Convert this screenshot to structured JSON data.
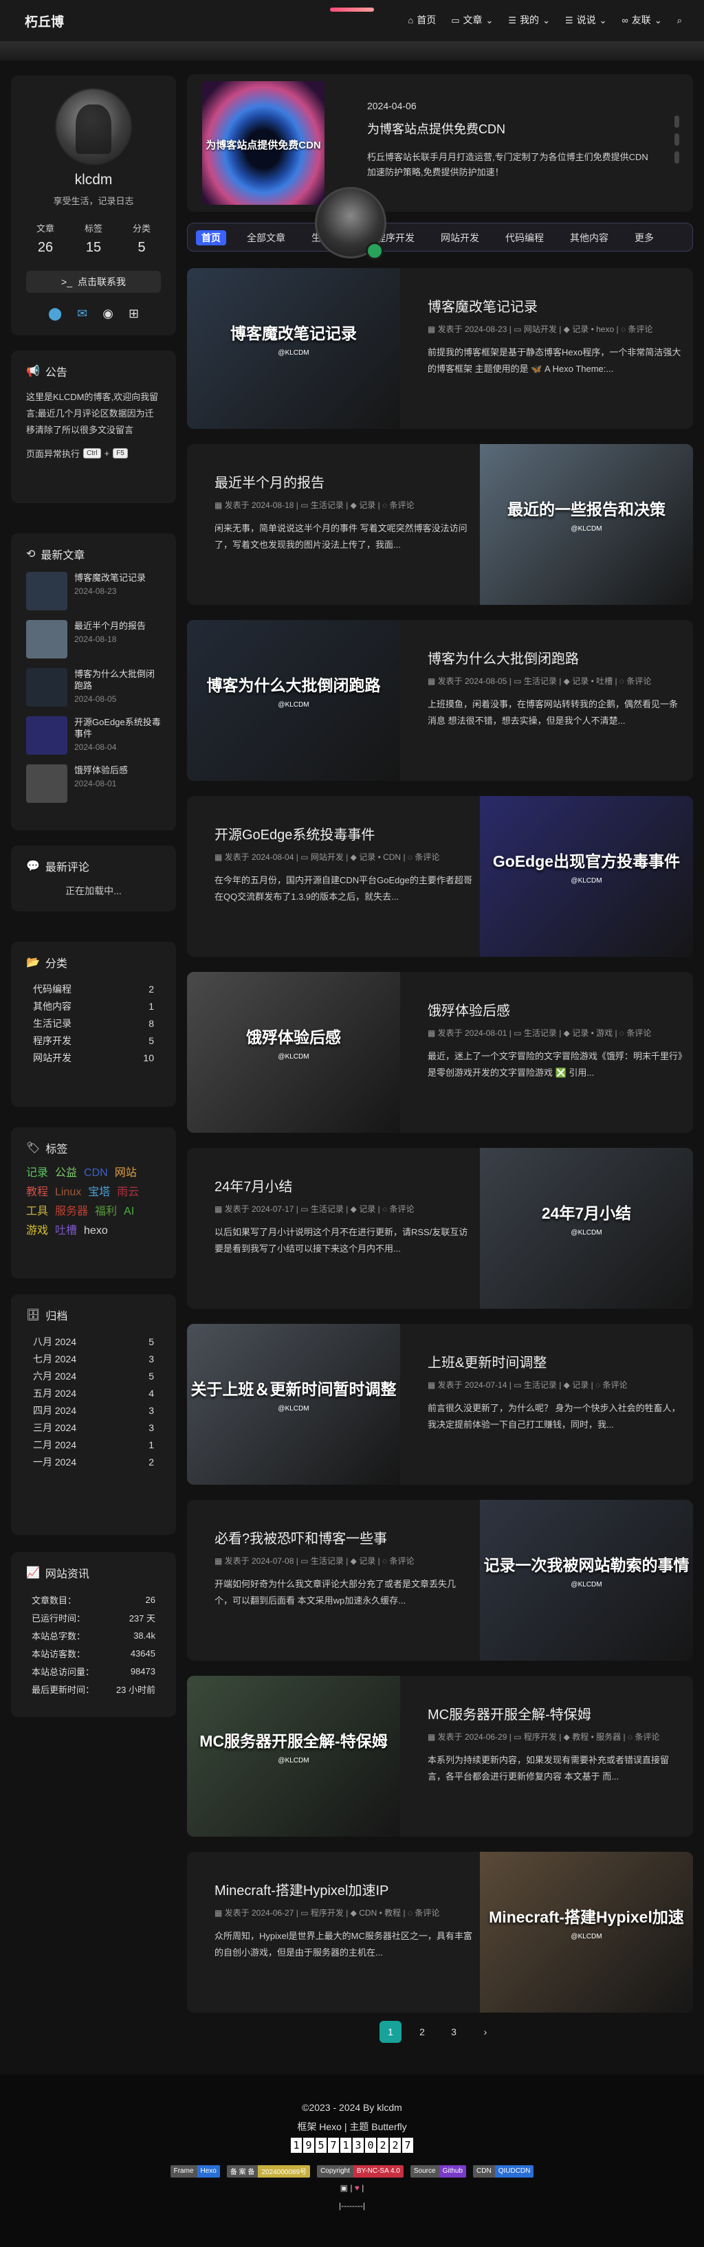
{
  "site": {
    "title": "朽丘博"
  },
  "nav": [
    {
      "label": "首页",
      "icon": "home-icon",
      "glyph": "⌂"
    },
    {
      "label": "文章",
      "icon": "folder-icon",
      "glyph": "▭"
    },
    {
      "label": "我的",
      "icon": "list-icon",
      "glyph": "☰"
    },
    {
      "label": "说说",
      "icon": "list-icon",
      "glyph": "☰"
    },
    {
      "label": "友联",
      "icon": "link-icon",
      "glyph": "∞"
    }
  ],
  "profile": {
    "name": "klcdm",
    "desc": "享受生活，记录日志",
    "stats": [
      {
        "label": "文章",
        "value": "26"
      },
      {
        "label": "标签",
        "value": "15"
      },
      {
        "label": "分类",
        "value": "5"
      }
    ],
    "contact": "点击联系我"
  },
  "notice": {
    "title": "公告",
    "body": "这里是KLCDM的博客,欢迎向我留言;最近几个月评论区数据因为迁移清除了所以很多文没留言",
    "foot_prefix": "页面异常执行",
    "key1": "Ctrl",
    "plus": "+",
    "key2": "F5"
  },
  "recent": {
    "title": "最新文章",
    "items": [
      {
        "title": "博客魔改笔记记录",
        "date": "2024-08-23"
      },
      {
        "title": "最近半个月的报告",
        "date": "2024-08-18"
      },
      {
        "title": "博客为什么大批倒闭跑路",
        "date": "2024-08-05"
      },
      {
        "title": "开源GoEdge系统投毒事件",
        "date": "2024-08-04"
      },
      {
        "title": "饿殍体验后感",
        "date": "2024-08-01"
      }
    ]
  },
  "comments": {
    "title": "最新评论",
    "loading": "正在加载中..."
  },
  "categories": {
    "title": "分类",
    "items": [
      {
        "name": "代码编程",
        "count": "2"
      },
      {
        "name": "其他内容",
        "count": "1"
      },
      {
        "name": "生活记录",
        "count": "8"
      },
      {
        "name": "程序开发",
        "count": "5"
      },
      {
        "name": "网站开发",
        "count": "10"
      }
    ]
  },
  "tags": {
    "title": "标签",
    "items": [
      {
        "name": "记录",
        "color": "#5cc35c"
      },
      {
        "name": "公益",
        "color": "#7cc86a"
      },
      {
        "name": "CDN",
        "color": "#3d62c8"
      },
      {
        "name": "网站",
        "color": "#e0a040"
      },
      {
        "name": "教程",
        "color": "#d0504a"
      },
      {
        "name": "Linux",
        "color": "#a05a3a"
      },
      {
        "name": "宝塔",
        "color": "#4aa0d8"
      },
      {
        "name": "雨云",
        "color": "#b03040"
      },
      {
        "name": "工具",
        "color": "#c8b040"
      },
      {
        "name": "服务器",
        "color": "#c04030"
      },
      {
        "name": "福利",
        "color": "#5a9a3a"
      },
      {
        "name": "AI",
        "color": "#4ab040"
      },
      {
        "name": "游戏",
        "color": "#d8c030"
      },
      {
        "name": "吐槽",
        "color": "#7a58c8"
      },
      {
        "name": "hexo",
        "color": "#d8d8d8"
      }
    ]
  },
  "archive": {
    "title": "归档",
    "items": [
      {
        "name": "八月 2024",
        "count": "5"
      },
      {
        "name": "七月 2024",
        "count": "3"
      },
      {
        "name": "六月 2024",
        "count": "5"
      },
      {
        "name": "五月 2024",
        "count": "4"
      },
      {
        "name": "四月 2024",
        "count": "3"
      },
      {
        "name": "三月 2024",
        "count": "3"
      },
      {
        "name": "二月 2024",
        "count": "1"
      },
      {
        "name": "一月 2024",
        "count": "2"
      }
    ]
  },
  "site_info": {
    "title": "网站资讯",
    "items": [
      {
        "name": "文章数目：",
        "value": "26"
      },
      {
        "name": "已运行时间：",
        "value": "237 天"
      },
      {
        "name": "本站总字数：",
        "value": "38.4k"
      },
      {
        "name": "本站访客数：",
        "value": "43645"
      },
      {
        "name": "本站总访问量：",
        "value": "98473"
      },
      {
        "name": "最后更新时间：",
        "value": "23 小时前"
      }
    ]
  },
  "hero": {
    "date": "2024-04-06",
    "title": "为博客站点提供免费CDN",
    "desc": "朽丘博客站长联手月月打造运营,专门定制了为各位博主们免费提供CDN加速防护策略,免费提供防护加速！",
    "img_text": "为博客站点提供免费CDN"
  },
  "tabs": [
    "首页",
    "全部文章",
    "生活记录",
    "程序开发",
    "网站开发",
    "代码编程",
    "其他内容",
    "更多"
  ],
  "posts": [
    {
      "title": "博客魔改笔记记录",
      "date": "发表于 2024-08-23",
      "category": "网站开发",
      "tags": "记录 • hexo",
      "comments": "条评论",
      "excerpt": "前提我的博客框架是基于静态博客Hexo程序，一个非常简洁强大的博客框架 主题使用的是 🦋 A Hexo Theme:...",
      "img_text": "博客魔改笔记记录",
      "img_sub": "@KLCDM",
      "img_bg": "#2c3848",
      "img_side": "left"
    },
    {
      "title": "最近半个月的报告",
      "date": "发表于 2024-08-18",
      "category": "生活记录",
      "tags": "记录",
      "comments": "条评论",
      "excerpt": "闲来无事，简单说说这半个月的事件 写着文呢突然博客没法访问了，写着文也发现我的图片没法上传了，我面...",
      "img_text": "最近的一些报告和决策",
      "img_sub": "@KLCDM",
      "img_bg": "#5a6a78",
      "img_side": "right"
    },
    {
      "title": "博客为什么大批倒闭跑路",
      "date": "发表于 2024-08-05",
      "category": "生活记录",
      "tags": "记录 • 吐槽",
      "comments": "条评论",
      "excerpt": "上班摸鱼，闲着没事，在博客网站转转我的企鹅，偶然看见一条消息 想法很不错，想去实操，但是我个人不清楚...",
      "img_text": "博客为什么大批倒闭跑路",
      "img_sub": "@KLCDM",
      "img_bg": "#222a36",
      "img_side": "left"
    },
    {
      "title": "开源GoEdge系统投毒事件",
      "date": "发表于 2024-08-04",
      "category": "网站开发",
      "tags": "记录 • CDN",
      "comments": "条评论",
      "excerpt": "在今年的五月份，国内开源自建CDN平台GoEdge的主要作者超哥在QQ交流群发布了1.3.9的版本之后，就失去...",
      "img_text": "GoEdge出现官方投毒事件",
      "img_sub": "@KLCDM",
      "img_bg": "#2a2a6a",
      "img_side": "right"
    },
    {
      "title": "饿殍体验后感",
      "date": "发表于 2024-08-01",
      "category": "生活记录",
      "tags": "记录 • 游戏",
      "comments": "条评论",
      "excerpt": "最近，迷上了一个文字冒险的文字冒险游戏《饿殍：明末千里行》是零创游戏开发的文字冒险游戏 ❎ 引用...",
      "img_text": "饿殍体验后感",
      "img_sub": "@KLCDM",
      "img_bg": "#4a4a4a",
      "img_side": "left"
    },
    {
      "title": "24年7月小结",
      "date": "发表于 2024-07-17",
      "category": "生活记录",
      "tags": "记录",
      "comments": "条评论",
      "excerpt": "以后如果写了月小计说明这个月不在进行更新，请RSS/友联互访要是看到我写了小结可以接下来这个月内不用...",
      "img_text": "24年7月小结",
      "img_sub": "@KLCDM",
      "img_bg": "#3a4048",
      "img_side": "right"
    },
    {
      "title": "上班&更新时间调整",
      "date": "发表于 2024-07-14",
      "category": "生活记录",
      "tags": "记录",
      "comments": "条评论",
      "excerpt": "前言很久没更新了，为什么呢？ 身为一个快步入社会的牲畜人，我决定提前体验一下自己打工赚钱，同时，我...",
      "img_text": "关于上班＆更新时间暂时调整",
      "img_sub": "@KLCDM",
      "img_bg": "#4a5058",
      "img_side": "left"
    },
    {
      "title": "必看?我被恐吓和博客一些事",
      "date": "发表于 2024-07-08",
      "category": "生活记录",
      "tags": "记录",
      "comments": "条评论",
      "excerpt": "开端如何好奇为什么我文章评论大部分充了或者是文章丢失几个，可以翻到后面看 本文采用wp加速永久缓存...",
      "img_text": "记录一次我被网站勒索的事情",
      "img_sub": "@KLCDM",
      "img_bg": "#2e3440",
      "img_side": "right"
    },
    {
      "title": "MC服务器开服全解-特保姆",
      "date": "发表于 2024-06-29",
      "category": "程序开发",
      "tags": "教程 • 服务器",
      "comments": "条评论",
      "excerpt": "本系列为持续更新内容，如果发现有需要补充或者错误直接留言，各平台都会进行更新修复内容 本文基于 而...",
      "img_text": "MC服务器开服全解-特保姆",
      "img_sub": "@KLCDM",
      "img_bg": "#3a4a3a",
      "img_side": "left"
    },
    {
      "title": "Minecraft-搭建Hypixel加速IP",
      "date": "发表于 2024-06-27",
      "category": "程序开发",
      "tags": "CDN • 教程",
      "comments": "条评论",
      "excerpt": "众所周知，Hypixel是世界上最大的MC服务器社区之一，具有丰富的自创小游戏，但是由于服务器的主机在...",
      "img_text": "Minecraft-搭建Hypixel加速",
      "img_sub": "@KLCDM",
      "img_bg": "#5a4a38",
      "img_side": "right"
    }
  ],
  "pager": [
    "1",
    "2",
    "3",
    "›"
  ],
  "footer": {
    "copyright": "©2023 - 2024 By klcdm",
    "framework": "框架 Hexo | 主题 Butterfly",
    "counter": [
      "1",
      "9",
      "5",
      "7",
      "1",
      "3",
      "0",
      "2",
      "2",
      "7"
    ],
    "badges": [
      {
        "l": "Frame",
        "r": "Hexo",
        "color": "#2a6fd6"
      },
      {
        "l": "备 案 备",
        "r": "2024000089号",
        "color": "#c8b040"
      },
      {
        "l": "Copyright",
        "r": "BY-NC-SA 4.0",
        "color": "#c83040"
      },
      {
        "l": "Source",
        "r": "Github",
        "color": "#7a3ac8"
      },
      {
        "l": "CDN",
        "r": "QIUDCDN",
        "color": "#2a6fd6"
      }
    ],
    "bottom_text": "|--------|"
  }
}
